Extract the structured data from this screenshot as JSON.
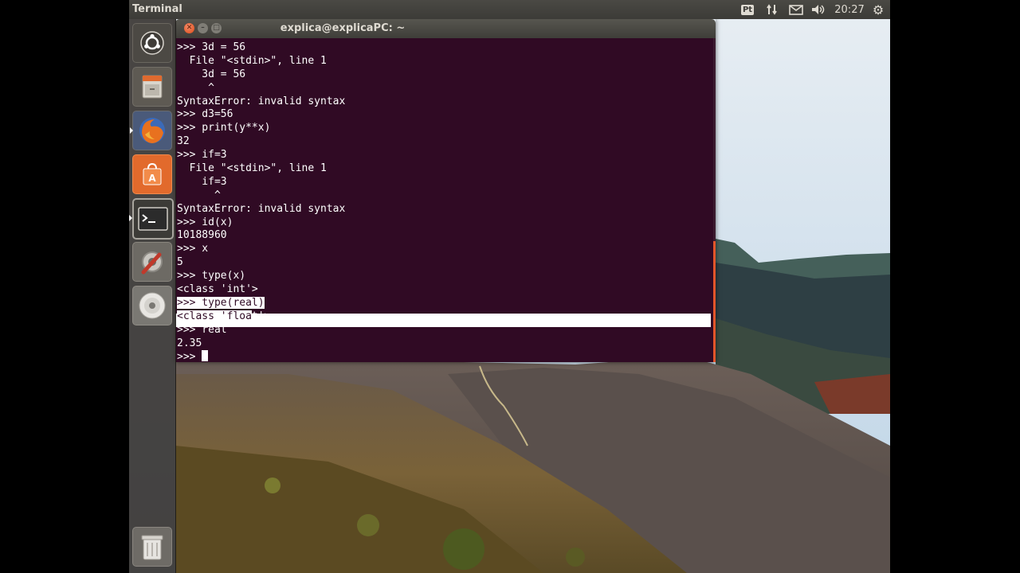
{
  "panel": {
    "title": "Terminal",
    "keyboard_layout": "Pt",
    "clock": "20:27"
  },
  "launcher": {
    "items": [
      "Dash Home",
      "Files",
      "Firefox Web Browser",
      "Ubuntu Software Center",
      "Terminal",
      "System Settings",
      "DVD",
      "Trash"
    ]
  },
  "window": {
    "title": "explica@explicaPC: ~"
  },
  "terminal": {
    "lines": [
      ">>> 3d = 56",
      "  File \"<stdin>\", line 1",
      "    3d = 56",
      "     ^",
      "SyntaxError: invalid syntax",
      ">>> d3=56",
      ">>> print(y**x)",
      "32",
      ">>> if=3",
      "  File \"<stdin>\", line 1",
      "    if=3",
      "      ^",
      "SyntaxError: invalid syntax",
      ">>> id(x)",
      "10188960",
      ">>> x",
      "5",
      ">>> type(x)",
      "<class 'int'>",
      ">>> type(real)",
      "<class 'float'>",
      ">>> real",
      "2.35",
      ">>> "
    ],
    "selected_line_19_tail": "(real)",
    "selected_line_19_head": ">>> type",
    "selected_line_20_head": "<class 'floa",
    "selected_line_20_tail": "t'>"
  },
  "colors": {
    "terminal_bg": "#300a24",
    "terminal_fg": "#ffffff",
    "accent": "#df4b16",
    "panel_bg": "#3c3b37"
  }
}
